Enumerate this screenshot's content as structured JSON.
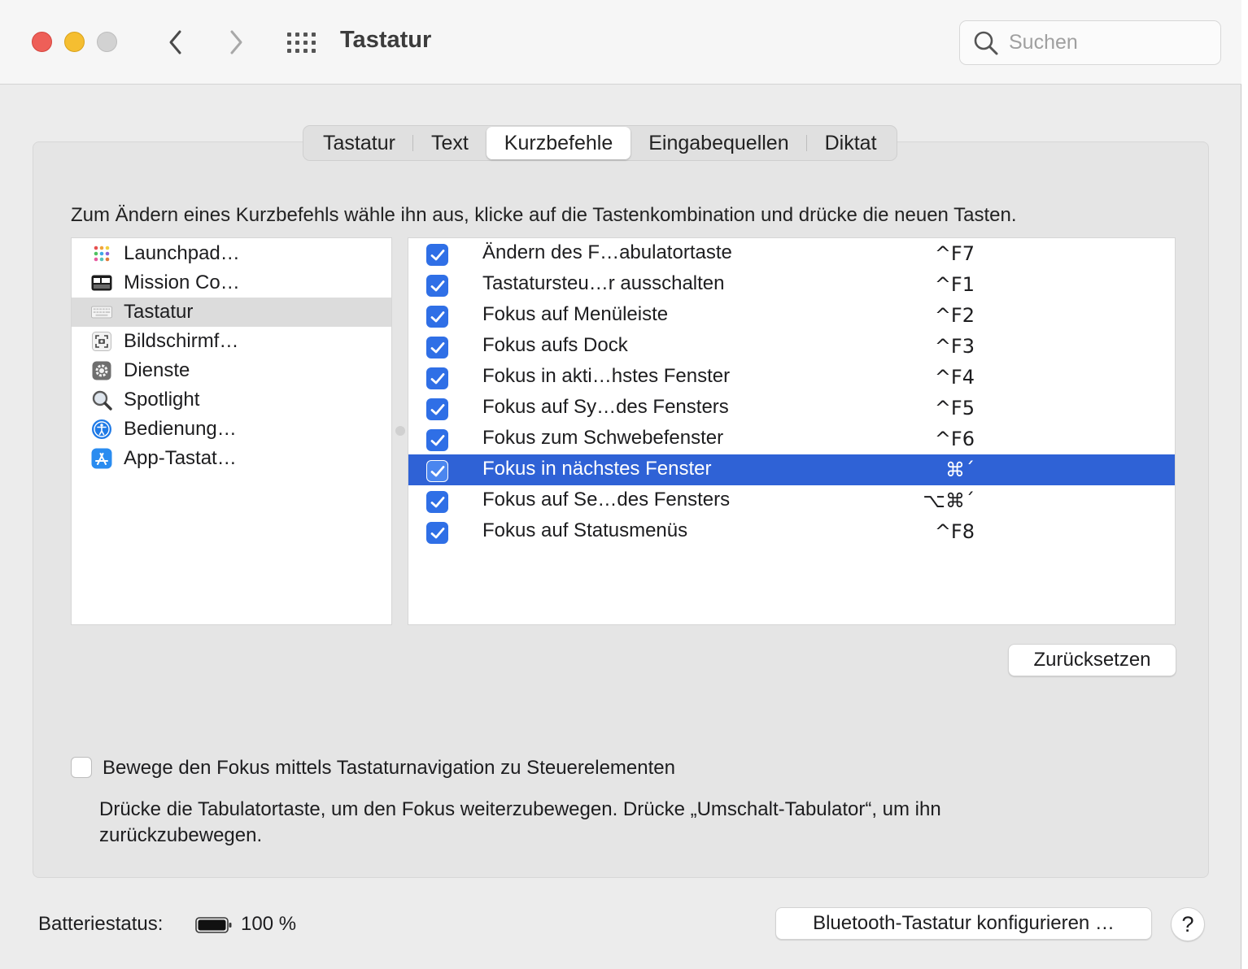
{
  "window": {
    "title": "Tastatur"
  },
  "search": {
    "placeholder": "Suchen"
  },
  "tabs": [
    {
      "label": "Tastatur",
      "active": false
    },
    {
      "label": "Text",
      "active": false
    },
    {
      "label": "Kurzbefehle",
      "active": true
    },
    {
      "label": "Eingabequellen",
      "active": false
    },
    {
      "label": "Diktat",
      "active": false
    }
  ],
  "instruction": "Zum Ändern eines Kurzbefehls wähle ihn aus, klicke auf die Tastenkombination und drücke die neuen Tasten.",
  "categories": [
    {
      "label": "Launchpad…",
      "icon": "launchpad-icon",
      "selected": false
    },
    {
      "label": "Mission Co…",
      "icon": "mission-control-icon",
      "selected": false
    },
    {
      "label": "Tastatur",
      "icon": "keyboard-icon",
      "selected": true
    },
    {
      "label": "Bildschirmf…",
      "icon": "screenshot-icon",
      "selected": false
    },
    {
      "label": "Dienste",
      "icon": "gear-icon",
      "selected": false
    },
    {
      "label": "Spotlight",
      "icon": "magnifier-icon",
      "selected": false
    },
    {
      "label": "Bedienung…",
      "icon": "accessibility-icon",
      "selected": false
    },
    {
      "label": "App-Tastat…",
      "icon": "app-store-icon",
      "selected": false
    }
  ],
  "shortcuts": [
    {
      "name": "Ändern des F…abulatortaste",
      "keys": "^F7",
      "checked": true,
      "selected": false
    },
    {
      "name": "Tastatursteu…r ausschalten",
      "keys": "^F1",
      "checked": true,
      "selected": false
    },
    {
      "name": "Fokus auf Menüleiste",
      "keys": "^F2",
      "checked": true,
      "selected": false
    },
    {
      "name": "Fokus aufs Dock",
      "keys": "^F3",
      "checked": true,
      "selected": false
    },
    {
      "name": "Fokus in akti…hstes Fenster",
      "keys": "^F4",
      "checked": true,
      "selected": false
    },
    {
      "name": "Fokus auf Sy…des Fensters",
      "keys": "^F5",
      "checked": true,
      "selected": false
    },
    {
      "name": "Fokus zum Schwebefenster",
      "keys": "^F6",
      "checked": true,
      "selected": false
    },
    {
      "name": "Fokus in nächstes Fenster",
      "keys": "⌘´",
      "checked": true,
      "selected": true
    },
    {
      "name": "Fokus auf Se…des Fensters",
      "keys": "⌥⌘´",
      "checked": true,
      "selected": false
    },
    {
      "name": "Fokus auf Statusmenüs",
      "keys": "^F8",
      "checked": true,
      "selected": false
    }
  ],
  "buttons": {
    "reset": "Zurücksetzen",
    "bluetooth": "Bluetooth-Tastatur konfigurieren …",
    "help": "?"
  },
  "option": {
    "label": "Bewege den Fokus mittels Tastaturnavigation zu Steuerelementen",
    "checked": false,
    "description": "Drücke die Tabulatortaste, um den Fokus weiterzubewegen. Drücke „Umschalt-Tabulator“, um ihn zurückzubewegen."
  },
  "battery": {
    "label": "Batteriestatus:",
    "value": "100 %"
  },
  "colors": {
    "accent": "#2f62d6",
    "checkbox": "#2f6fe6",
    "close": "#ee5f58",
    "minimize": "#f5be31"
  }
}
